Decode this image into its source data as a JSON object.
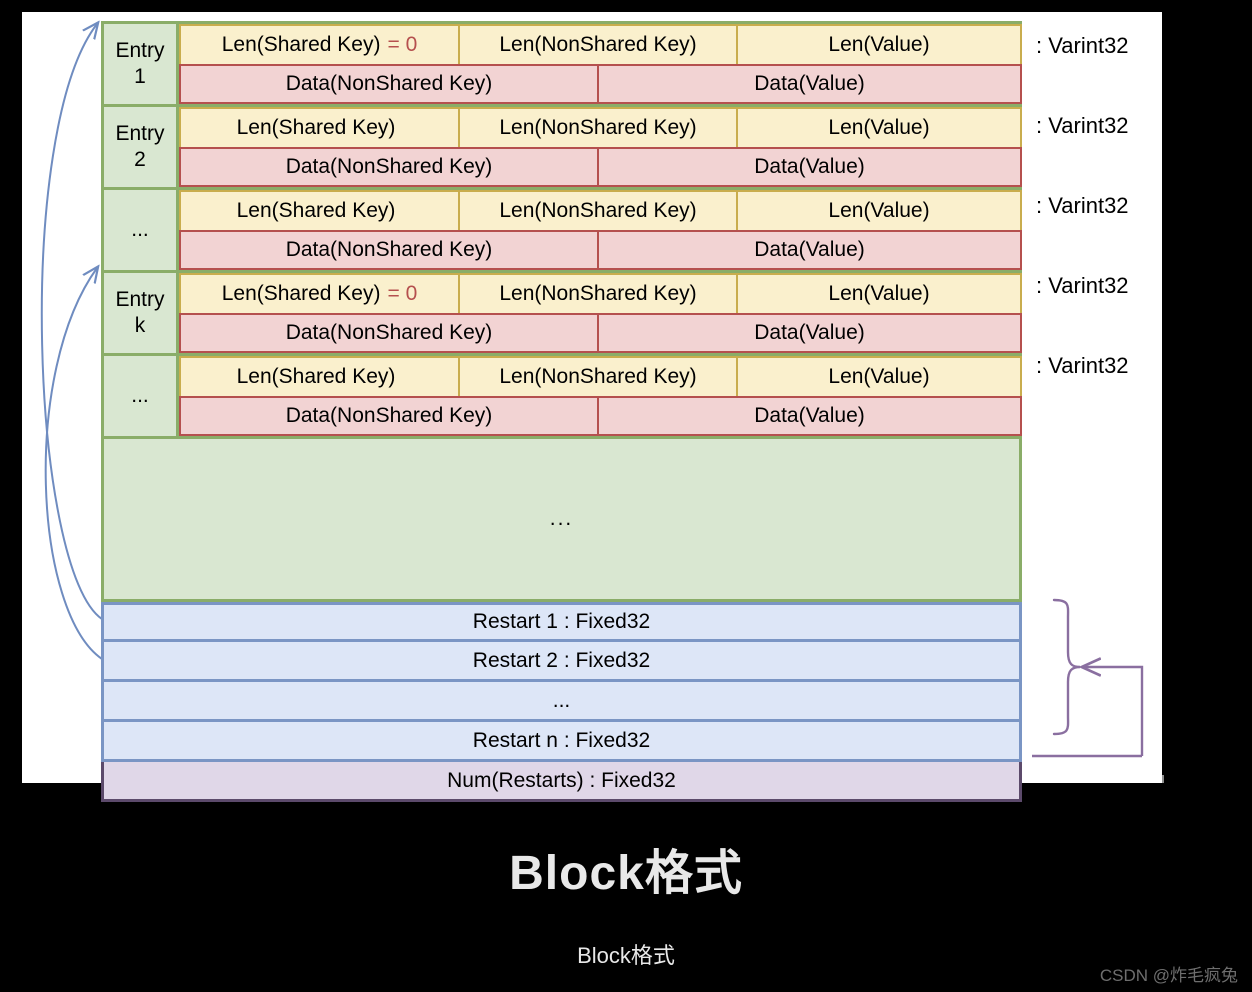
{
  "figure": {
    "title": "Block格式",
    "caption": "Block格式",
    "watermark": "CSDN @炸毛疯兔"
  },
  "colors": {
    "entry_label_fill": "#d9e7d1",
    "entry_label_border": "#8aad68",
    "len_fill": "#faf0cd",
    "len_border": "#c9ad4d",
    "data_fill": "#f2d3d3",
    "data_border": "#b5504e",
    "restart_fill": "#dde6f7",
    "restart_border": "#7a95c4",
    "numrestarts_fill": "#e0d7e8",
    "numrestarts_border": "#5c4a6b",
    "arrow_blue": "#6f8cc0",
    "arrow_purple": "#8a6fa0",
    "accent_red": "#b5504e",
    "canvas": "#ffffff",
    "background": "#000000"
  },
  "diagram": {
    "type": "block-format-layout",
    "entries": [
      {
        "label_line1": "Entry",
        "label_line2": "1",
        "len_shared_key": "Len(Shared Key)",
        "shared_key_eq": "= 0",
        "len_nonshared_key": "Len(NonShared Key)",
        "len_value": "Len(Value)",
        "data_nonshared_key": "Data(NonShared Key)",
        "data_value": "Data(Value)",
        "varint_label": ": Varint32"
      },
      {
        "label_line1": "Entry",
        "label_line2": "2",
        "len_shared_key": "Len(Shared Key)",
        "shared_key_eq": "",
        "len_nonshared_key": "Len(NonShared Key)",
        "len_value": "Len(Value)",
        "data_nonshared_key": "Data(NonShared Key)",
        "data_value": "Data(Value)",
        "varint_label": ": Varint32"
      },
      {
        "label_line1": "",
        "label_line2": "...",
        "len_shared_key": "Len(Shared Key)",
        "shared_key_eq": "",
        "len_nonshared_key": "Len(NonShared Key)",
        "len_value": "Len(Value)",
        "data_nonshared_key": "Data(NonShared Key)",
        "data_value": "Data(Value)",
        "varint_label": ": Varint32"
      },
      {
        "label_line1": "Entry",
        "label_line2": "k",
        "len_shared_key": "Len(Shared Key)",
        "shared_key_eq": "= 0",
        "len_nonshared_key": "Len(NonShared Key)",
        "len_value": "Len(Value)",
        "data_nonshared_key": "Data(NonShared Key)",
        "data_value": "Data(Value)",
        "varint_label": ": Varint32"
      },
      {
        "label_line1": "",
        "label_line2": "...",
        "len_shared_key": "Len(Shared Key)",
        "shared_key_eq": "",
        "len_nonshared_key": "Len(NonShared Key)",
        "len_value": "Len(Value)",
        "data_nonshared_key": "Data(NonShared Key)",
        "data_value": "Data(Value)",
        "varint_label": ": Varint32"
      }
    ],
    "filler_text": "...",
    "restarts": [
      "Restart 1 : Fixed32",
      "Restart 2 : Fixed32",
      "...",
      "Restart n : Fixed32"
    ],
    "num_restarts": "Num(Restarts) : Fixed32"
  }
}
